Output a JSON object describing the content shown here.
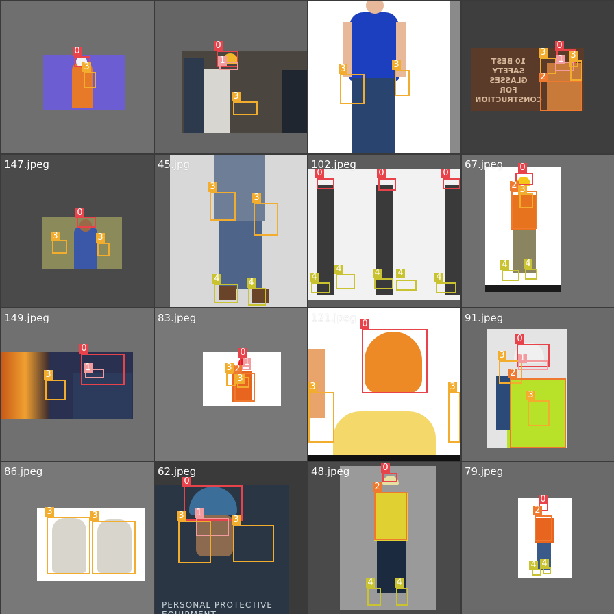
{
  "tiles": [
    {
      "name": ""
    },
    {
      "name": ""
    },
    {
      "name": ""
    },
    {
      "name": ""
    },
    {
      "name": "147.jpeg"
    },
    {
      "name": "45.jpg"
    },
    {
      "name": "102.jpeg"
    },
    {
      "name": "67.jpeg"
    },
    {
      "name": "149.jpeg"
    },
    {
      "name": "83.jpeg"
    },
    {
      "name": "121.jpeg"
    },
    {
      "name": "91.jpeg"
    },
    {
      "name": "86.jpeg"
    },
    {
      "name": "62.jpeg"
    },
    {
      "name": "48.jpeg"
    },
    {
      "name": "79.jpeg"
    }
  ],
  "class_labels": {
    "c0": "0",
    "c1": "1",
    "c2": "2",
    "c3": "3",
    "c4": "4"
  },
  "sign": {
    "line1": "10 BEST",
    "line2": "SAFETY",
    "line3": "GLASSES",
    "line4": "FOR",
    "line5": "CONSTRUCTION"
  },
  "ppe_caption": "PERSONAL PROTECTIVE EQUIPMENT",
  "colors": {
    "class0": "#e8434b",
    "class1": "#f39ca0",
    "class2": "#ef7a2f",
    "class3": "#f2ac2e",
    "class4": "#c9c231"
  }
}
